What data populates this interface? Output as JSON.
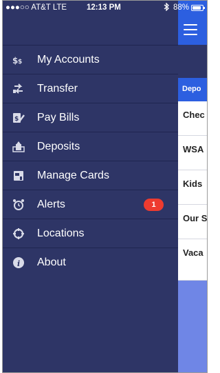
{
  "status_bar": {
    "carrier": "●●●○○ AT&T  LTE",
    "time": "12:13 PM",
    "bluetooth_icon": "bluetooth-icon",
    "battery_pct": "88%",
    "battery_level": 0.88
  },
  "drawer": {
    "items": [
      {
        "label": "My Accounts",
        "icon": "dollar-sign-icon"
      },
      {
        "label": "Transfer",
        "icon": "transfer-arrows-icon"
      },
      {
        "label": "Pay Bills",
        "icon": "pay-bills-icon"
      },
      {
        "label": "Deposits",
        "icon": "deposit-icon"
      },
      {
        "label": "Manage Cards",
        "icon": "card-icon"
      },
      {
        "label": "Alerts",
        "icon": "alarm-clock-icon",
        "badge": "1"
      },
      {
        "label": "Locations",
        "icon": "crosshair-icon"
      },
      {
        "label": "About",
        "icon": "info-icon"
      }
    ]
  },
  "main": {
    "menu_icon": "hamburger-icon",
    "tab_label": "Depo",
    "accounts": [
      "Chec",
      "WSA",
      "Kids",
      "Our S",
      "Vaca"
    ]
  },
  "colors": {
    "drawer_bg": "#2e3566",
    "header_blue": "#2c5fe0",
    "badge_red": "#ee3b2f"
  }
}
